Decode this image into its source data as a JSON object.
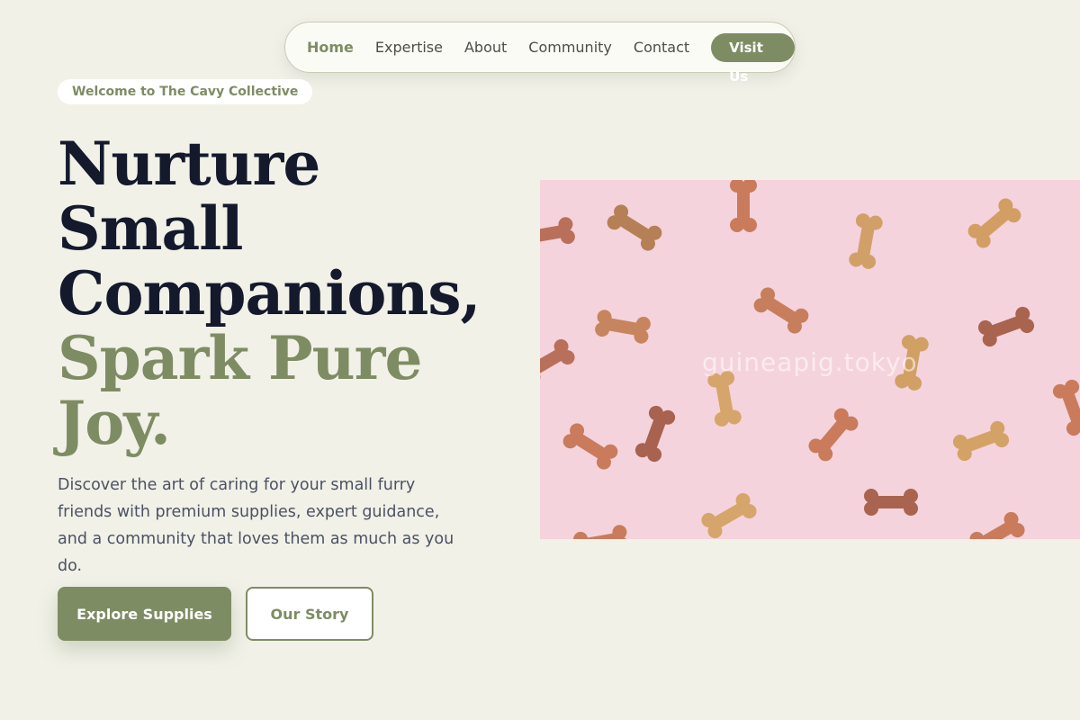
{
  "nav": {
    "items": [
      {
        "label": "Home",
        "active": true
      },
      {
        "label": "Expertise"
      },
      {
        "label": "About"
      },
      {
        "label": "Community"
      },
      {
        "label": "Contact"
      }
    ],
    "cta_label": "Visit Us"
  },
  "hero": {
    "badge": "Welcome to The Cavy Collective",
    "headline_lines": [
      "Nurture",
      "Small",
      "Companions,"
    ],
    "headline_accent_lines": [
      "Spark Pure",
      "Joy."
    ],
    "description": "Discover the art of caring for your small furry friends with premium supplies, expert guidance, and a community that loves them as much as you do.",
    "primary_button": "Explore Supplies",
    "secondary_button": "Our Story",
    "image": {
      "watermark": "guineapig.tokyo",
      "background_color": "#f5d3dc"
    }
  },
  "colors": {
    "accent": "#7e8c63",
    "page_background": "#f1f1e8",
    "headline": "#141a2c",
    "body_text": "#4b5262"
  }
}
